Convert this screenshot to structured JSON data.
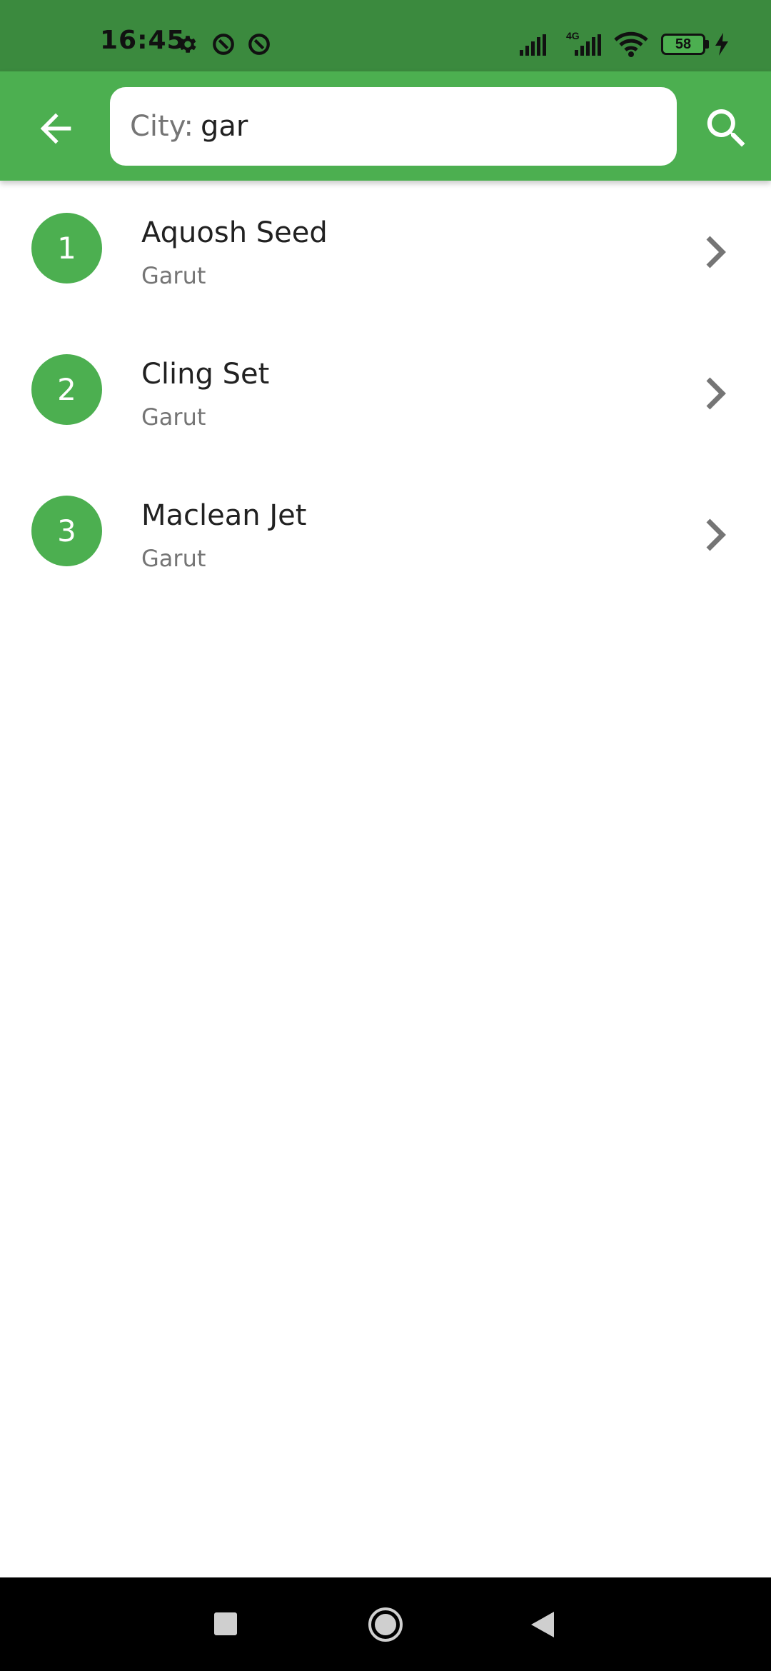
{
  "status_bar": {
    "time": "16:45",
    "network_label": "4G",
    "battery_level": "58",
    "icons": [
      "settings-icon",
      "sync-icon",
      "sync-icon",
      "signal-icon",
      "signal-icon",
      "wifi-icon",
      "battery-icon",
      "charging-icon"
    ]
  },
  "app_bar": {
    "back_icon": "arrow-left-icon",
    "search_prefix": "City:",
    "search_value": "gar",
    "search_icon": "search-icon",
    "accent_color": "#4caf50"
  },
  "results": [
    {
      "number": "1",
      "name": "Aquosh Seed",
      "city": "Garut"
    },
    {
      "number": "2",
      "name": "Cling Set",
      "city": "Garut"
    },
    {
      "number": "3",
      "name": "Maclean Jet",
      "city": "Garut"
    }
  ],
  "nav_bar": {
    "icons": [
      "recents-square-icon",
      "home-circle-icon",
      "back-triangle-icon"
    ]
  }
}
